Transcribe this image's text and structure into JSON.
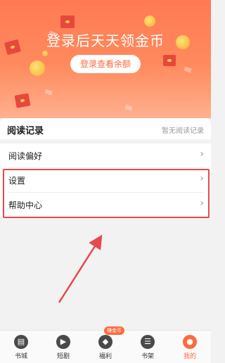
{
  "banner": {
    "title": "登录后天天领金币",
    "button_label": "登录查看余额"
  },
  "reading": {
    "title": "阅读记录",
    "empty_text": "暂无阅读记录"
  },
  "menu": {
    "items": [
      {
        "label": "阅读偏好",
        "icon": "chevron-right-icon"
      },
      {
        "label": "设置",
        "icon": "chevron-right-icon"
      },
      {
        "label": "帮助中心",
        "icon": "chevron-right-icon"
      }
    ]
  },
  "tabbar": {
    "items": [
      {
        "label": "书城",
        "icon": "bookstore-icon"
      },
      {
        "label": "短剧",
        "icon": "play-icon"
      },
      {
        "label": "福利",
        "icon": "gift-icon",
        "badge": "赚金币"
      },
      {
        "label": "书架",
        "icon": "bookshelf-icon"
      },
      {
        "label": "我的",
        "icon": "profile-icon",
        "active": true
      }
    ]
  },
  "colors": {
    "accent": "#ff6a3d",
    "highlight_border": "#e8474d"
  }
}
